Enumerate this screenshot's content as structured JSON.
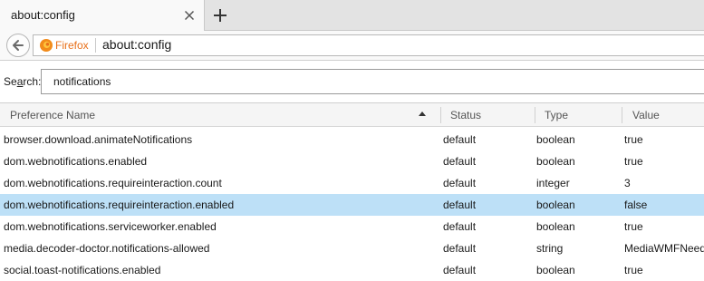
{
  "tab": {
    "title": "about:config"
  },
  "navbar": {
    "identity_label": "Firefox",
    "url": "about:config"
  },
  "search": {
    "label_prefix": "Se",
    "label_accel": "a",
    "label_suffix": "rch:",
    "value": "notifications"
  },
  "table": {
    "columns": [
      "Preference Name",
      "Status",
      "Type",
      "Value"
    ],
    "sort_column": "Preference Name",
    "rows": [
      {
        "name": "browser.download.animateNotifications",
        "status": "default",
        "type": "boolean",
        "value": "true"
      },
      {
        "name": "dom.webnotifications.enabled",
        "status": "default",
        "type": "boolean",
        "value": "true"
      },
      {
        "name": "dom.webnotifications.requireinteraction.count",
        "status": "default",
        "type": "integer",
        "value": "3"
      },
      {
        "name": "dom.webnotifications.requireinteraction.enabled",
        "status": "default",
        "type": "boolean",
        "value": "false",
        "selected": true
      },
      {
        "name": "dom.webnotifications.serviceworker.enabled",
        "status": "default",
        "type": "boolean",
        "value": "true"
      },
      {
        "name": "media.decoder-doctor.notifications-allowed",
        "status": "default",
        "type": "string",
        "value": "MediaWMFNeed"
      },
      {
        "name": "social.toast-notifications.enabled",
        "status": "default",
        "type": "boolean",
        "value": "true"
      }
    ]
  },
  "colors": {
    "selected_row": "#bde0f7",
    "identity_label": "#e8701a"
  }
}
